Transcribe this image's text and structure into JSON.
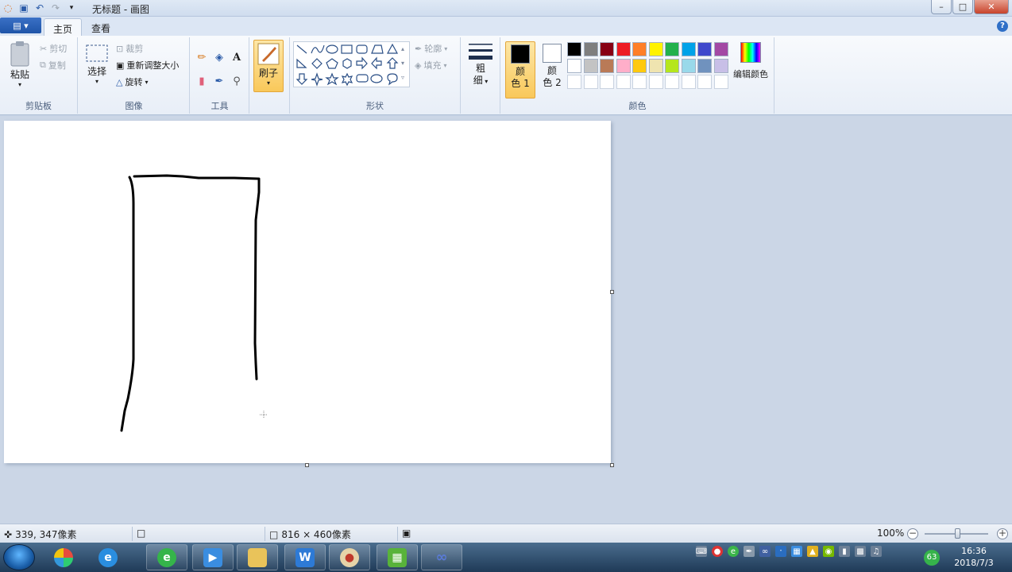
{
  "window": {
    "title": "无标题 - 画图",
    "minimize": "–",
    "maximize": "□",
    "close": "✕"
  },
  "tabs": {
    "file_glyph": "▤ ▾",
    "home": "主页",
    "view": "查看",
    "help_glyph": "?"
  },
  "clipboard": {
    "paste": "粘贴",
    "cut": "剪切",
    "copy": "复制",
    "group": "剪贴板"
  },
  "image": {
    "select": "选择",
    "crop": "裁剪",
    "resize": "重新调整大小",
    "rotate": "旋转",
    "group": "图像"
  },
  "tools": {
    "group": "工具",
    "text_glyph": "A"
  },
  "brushes": {
    "label": "刷子"
  },
  "shapes": {
    "outline": "轮廓",
    "fill": "填充",
    "group": "形状"
  },
  "size": {
    "label_line1": "粗",
    "label_line2": "细"
  },
  "colors": {
    "color1_line1": "颜",
    "color1_line2": "色 1",
    "color2_line1": "颜",
    "color2_line2": "色 2",
    "edit": "编辑颜色",
    "group": "颜色",
    "color1_value": "#000000",
    "color2_value": "#ffffff",
    "palette_row1": [
      "#000000",
      "#7f7f7f",
      "#880015",
      "#ed1c24",
      "#ff7f27",
      "#fff200",
      "#22b14c",
      "#00a2e8",
      "#3f48cc",
      "#a349a4"
    ],
    "palette_row2": [
      "#ffffff",
      "#c3c3c3",
      "#b97a57",
      "#ffaec9",
      "#ffc90e",
      "#efe4b0",
      "#b5e61d",
      "#99d9ea",
      "#7092be",
      "#c8bfe7"
    ],
    "palette_row3": [
      "#ffffff",
      "#ffffff",
      "#ffffff",
      "#ffffff",
      "#ffffff",
      "#ffffff",
      "#ffffff",
      "#ffffff",
      "#ffffff",
      "#ffffff"
    ]
  },
  "status": {
    "cursor_pos": "339, 347像素",
    "image_size": "816 × 460像素",
    "zoom": "100%"
  },
  "taskbar": {
    "badge": "63",
    "time": "16:36",
    "date": "2018/7/3"
  }
}
